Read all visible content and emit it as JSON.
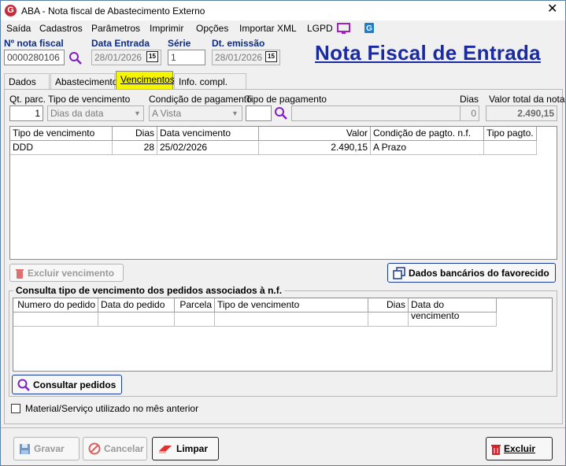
{
  "window": {
    "title": "ABA - Nota fiscal de Abastecimento Externo"
  },
  "menu": {
    "items": [
      "Saída",
      "Cadastros",
      "Parâmetros",
      "Imprimir",
      "Opções",
      "Importar XML",
      "LGPD"
    ]
  },
  "header": {
    "nota_label": "Nº nota fiscal",
    "nota_value": "0000280106",
    "data_entrada_label": "Data Entrada",
    "data_entrada_value": "28/01/2026",
    "serie_label": "Série",
    "serie_value": "1",
    "dt_emissao_label": "Dt. emissão",
    "dt_emissao_value": "28/01/2026",
    "page_title": "Nota Fiscal de Entrada",
    "cal_glyph": "15"
  },
  "tabs": [
    {
      "label": "Dados NF"
    },
    {
      "label": "Abastecimento"
    },
    {
      "label": "Vencimentos"
    },
    {
      "label": "Info. compl. Sped"
    }
  ],
  "vencimentos": {
    "qt_parc_label": "Qt. parc.",
    "qt_parc_value": "1",
    "tipo_venc_label": "Tipo de vencimento",
    "tipo_venc_value": "Dias da data",
    "cond_pag_label": "Condição de pagamento",
    "cond_pag_value": "A Vista",
    "tipo_pag_label": "Tipo de pagamento",
    "tipo_pag_value": "",
    "dias_label": "Dias",
    "dias_value": "0",
    "valor_total_label": "Valor total da nota",
    "valor_total_value": "2.490,15",
    "grid_headers": [
      "Tipo de vencimento",
      "Dias",
      "Data vencimento",
      "Valor",
      "Condição de pagto. n.f.",
      "Tipo pagto."
    ],
    "rows": [
      {
        "tipo": "DDD",
        "dias": "28",
        "data": "25/02/2026",
        "valor": "2.490,15",
        "condicao": "A Prazo",
        "tipo_pagto": ""
      }
    ],
    "excluir_venc_label": "Excluir vencimento",
    "dados_bancarios_label": "Dados bancários do favorecido"
  },
  "consulta": {
    "title": "Consulta tipo de vencimento dos pedidos associados à n.f.",
    "headers": [
      "Numero do pedido",
      "Data do pedido",
      "Parcela",
      "Tipo de vencimento",
      "Dias",
      "Data do vencimento"
    ],
    "consultar_label": "Consultar pedidos"
  },
  "checkbox_label": "Material/Serviço utilizado no mês anterior",
  "footer": {
    "gravar": "Gravar",
    "cancelar": "Cancelar",
    "limpar": "Limpar",
    "excluir": "Excluir"
  },
  "colors": {
    "accent": "#1a2aa0",
    "active_tab": "#f5f500",
    "danger": "#d3202a"
  }
}
